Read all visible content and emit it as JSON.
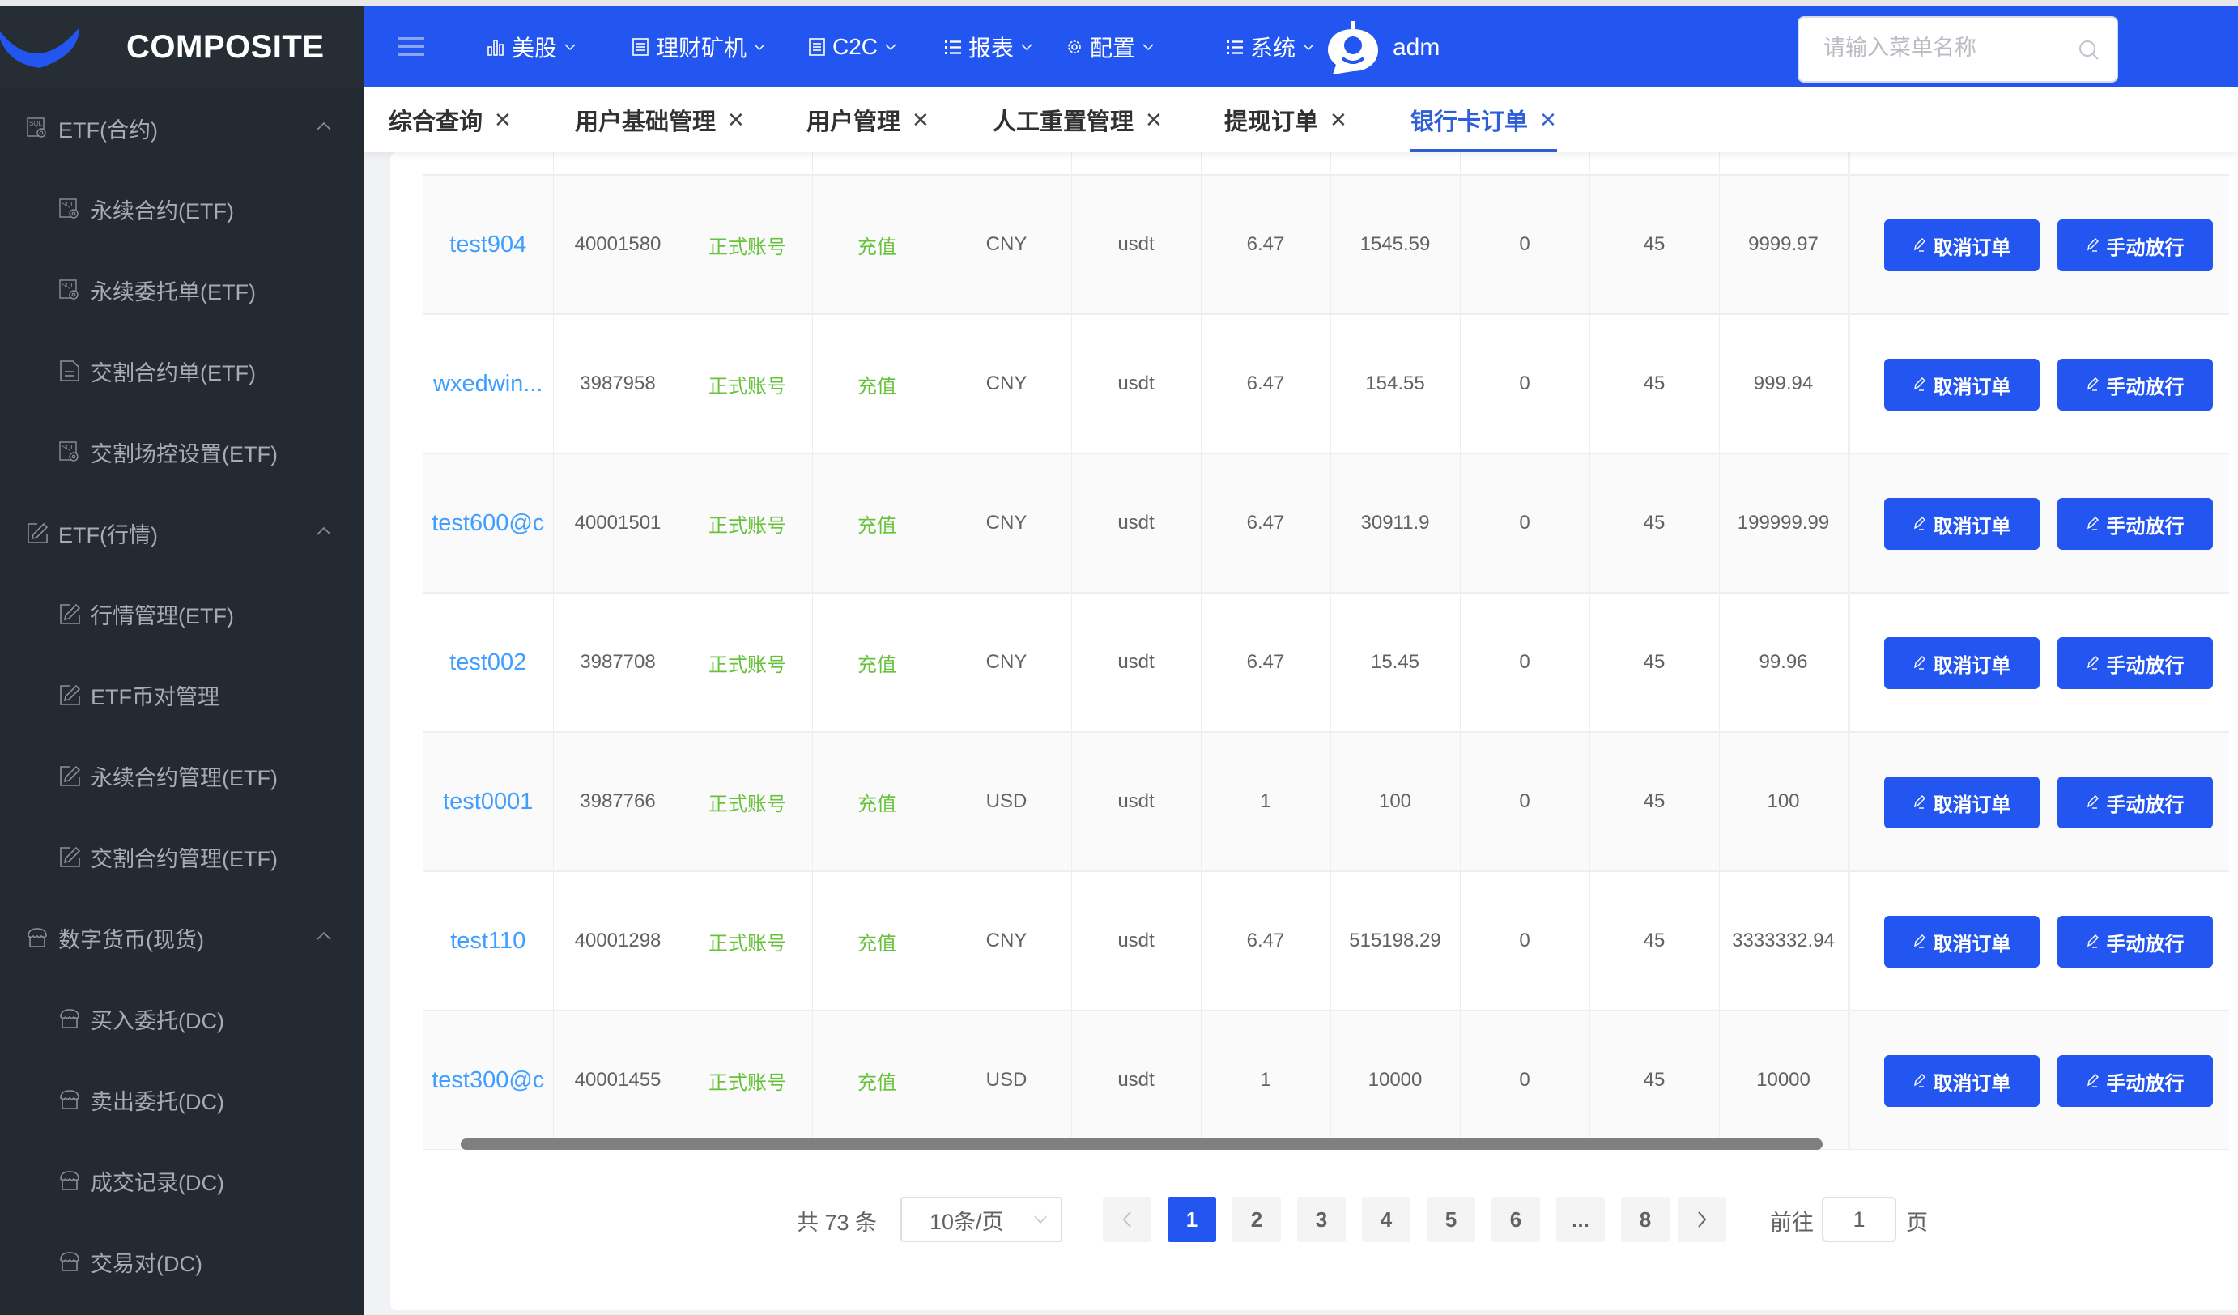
{
  "brand": {
    "name": "COMPOSITE"
  },
  "sidebar": {
    "groups": [
      {
        "label": "ETF(合约)",
        "icon": "sql-settings-icon",
        "expanded": true,
        "items": [
          {
            "label": "永续合约(ETF)",
            "icon": "sql-settings-icon"
          },
          {
            "label": "永续委托单(ETF)",
            "icon": "sql-settings-icon"
          },
          {
            "label": "交割合约单(ETF)",
            "icon": "document-icon"
          },
          {
            "label": "交割场控设置(ETF)",
            "icon": "sql-settings-icon"
          }
        ]
      },
      {
        "label": "ETF(行情)",
        "icon": "edit-icon",
        "expanded": true,
        "items": [
          {
            "label": "行情管理(ETF)",
            "icon": "edit-icon"
          },
          {
            "label": "ETF币对管理",
            "icon": "edit-icon"
          },
          {
            "label": "永续合约管理(ETF)",
            "icon": "edit-icon"
          },
          {
            "label": "交割合约管理(ETF)",
            "icon": "edit-icon"
          }
        ]
      },
      {
        "label": "数字货币(现货)",
        "icon": "shop-icon",
        "expanded": true,
        "items": [
          {
            "label": "买入委托(DC)",
            "icon": "shop-icon"
          },
          {
            "label": "卖出委托(DC)",
            "icon": "shop-icon"
          },
          {
            "label": "成交记录(DC)",
            "icon": "shop-icon"
          },
          {
            "label": "交易对(DC)",
            "icon": "shop-icon"
          }
        ]
      }
    ]
  },
  "header": {
    "nav": [
      {
        "label": "美股",
        "icon": "bar-chart-icon"
      },
      {
        "label": "理财矿机",
        "icon": "list-box-icon"
      },
      {
        "label": "C2C",
        "icon": "list-box-icon"
      },
      {
        "label": "报表",
        "icon": "list-icon"
      },
      {
        "label": "配置",
        "icon": "gear-icon"
      },
      {
        "label": "系统",
        "icon": "list-icon"
      }
    ],
    "search_placeholder": "请输入菜单名称",
    "username": "adm"
  },
  "tabs": [
    {
      "label": "综合查询",
      "active": false
    },
    {
      "label": "用户基础管理",
      "active": false
    },
    {
      "label": "用户管理",
      "active": false
    },
    {
      "label": "人工重置管理",
      "active": false
    },
    {
      "label": "提现订单",
      "active": false
    },
    {
      "label": "银行卡订单",
      "active": true
    }
  ],
  "table": {
    "rows": [
      {
        "user": "test904",
        "uid": "40001580",
        "account_type": "正式账号",
        "order_type": "充值",
        "currency": "CNY",
        "coin": "usdt",
        "rate": "6.47",
        "amount": "1545.59",
        "fee": "0",
        "c10": "45",
        "total": "9999.97"
      },
      {
        "user": "wxedwin...",
        "uid": "3987958",
        "account_type": "正式账号",
        "order_type": "充值",
        "currency": "CNY",
        "coin": "usdt",
        "rate": "6.47",
        "amount": "154.55",
        "fee": "0",
        "c10": "45",
        "total": "999.94"
      },
      {
        "user": "test600@c",
        "uid": "40001501",
        "account_type": "正式账号",
        "order_type": "充值",
        "currency": "CNY",
        "coin": "usdt",
        "rate": "6.47",
        "amount": "30911.9",
        "fee": "0",
        "c10": "45",
        "total": "199999.99"
      },
      {
        "user": "test002",
        "uid": "3987708",
        "account_type": "正式账号",
        "order_type": "充值",
        "currency": "CNY",
        "coin": "usdt",
        "rate": "6.47",
        "amount": "15.45",
        "fee": "0",
        "c10": "45",
        "total": "99.96"
      },
      {
        "user": "test0001",
        "uid": "3987766",
        "account_type": "正式账号",
        "order_type": "充值",
        "currency": "USD",
        "coin": "usdt",
        "rate": "1",
        "amount": "100",
        "fee": "0",
        "c10": "45",
        "total": "100"
      },
      {
        "user": "test110",
        "uid": "40001298",
        "account_type": "正式账号",
        "order_type": "充值",
        "currency": "CNY",
        "coin": "usdt",
        "rate": "6.47",
        "amount": "515198.29",
        "fee": "0",
        "c10": "45",
        "total": "3333332.94"
      },
      {
        "user": "test300@c",
        "uid": "40001455",
        "account_type": "正式账号",
        "order_type": "充值",
        "currency": "USD",
        "coin": "usdt",
        "rate": "1",
        "amount": "10000",
        "fee": "0",
        "c10": "45",
        "total": "10000"
      }
    ],
    "actions": {
      "cancel_label": "取消订单",
      "release_label": "手动放行"
    }
  },
  "pagination": {
    "total_text": "共 73 条",
    "page_size": "10条/页",
    "pages": [
      "1",
      "2",
      "3",
      "4",
      "5",
      "6",
      "...",
      "8"
    ],
    "current_page": "1",
    "goto_label": "前往",
    "goto_value": "1",
    "page_suffix": "页"
  },
  "colors": {
    "primary": "#2356f0",
    "sidebar_bg": "#232a31",
    "link": "#409eff",
    "success": "#67c23a"
  }
}
